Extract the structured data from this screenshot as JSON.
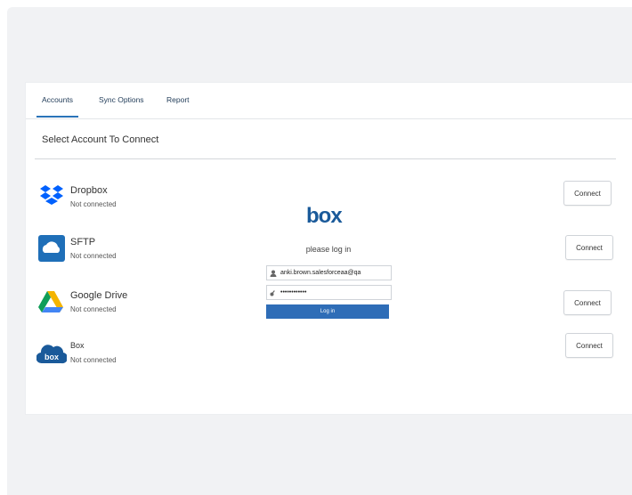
{
  "tabs": [
    {
      "label": "Accounts"
    },
    {
      "label": "Sync Options"
    },
    {
      "label": "Report"
    }
  ],
  "section_title": "Select Account To Connect",
  "accounts": [
    {
      "name": "Dropbox",
      "status": "Not connected",
      "action": "Connect",
      "icon": "dropbox-icon"
    },
    {
      "name": "SFTP",
      "status": "Not connected",
      "action": "Connect",
      "icon": "sftp-cloud-icon"
    },
    {
      "name": "Google Drive",
      "status": "Not connected",
      "action": "Connect",
      "icon": "google-drive-icon"
    },
    {
      "name": "Box",
      "status": "Not connected",
      "action": "Connect",
      "icon": "box-cloud-icon"
    }
  ],
  "box_login": {
    "logo": "box",
    "prompt": "please log in",
    "username_value": "anki.brown.salesforceaa@qa",
    "password_value": "••••••••••••",
    "button_label": "Log in"
  },
  "colors": {
    "accent": "#2a73b8",
    "box_blue": "#1a5a9a",
    "dropbox_blue": "#0061fe",
    "login_button": "#2e6db7"
  }
}
